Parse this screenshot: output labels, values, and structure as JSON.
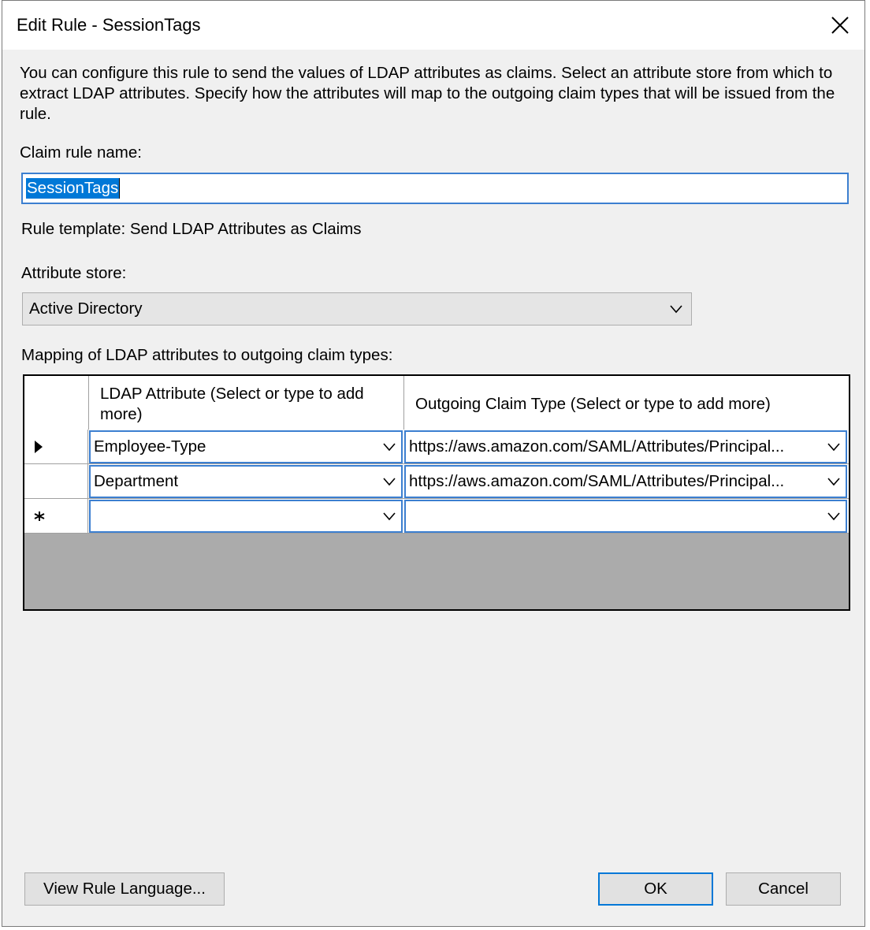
{
  "window": {
    "title": "Edit Rule - SessionTags"
  },
  "dialog": {
    "description": "You can configure this rule to send the values of LDAP attributes as claims. Select an attribute store from which to extract LDAP attributes. Specify how the attributes will map to the outgoing claim types that will be issued from the rule.",
    "claim_rule_name_label": "Claim rule name:",
    "claim_rule_name_value": "SessionTags",
    "rule_template": "Rule template: Send LDAP Attributes as Claims",
    "attribute_store_label": "Attribute store:",
    "attribute_store_value": "Active Directory",
    "mapping_label": "Mapping of LDAP attributes to outgoing claim types:"
  },
  "grid": {
    "columns": [
      "LDAP Attribute (Select or type to add more)",
      "Outgoing Claim Type (Select or type to add more)"
    ],
    "rows": [
      {
        "ldap": "Employee-Type",
        "claim": "https://aws.amazon.com/SAML/Attributes/Principal..."
      },
      {
        "ldap": "Department",
        "claim": "https://aws.amazon.com/SAML/Attributes/Principal..."
      },
      {
        "ldap": "",
        "claim": ""
      }
    ]
  },
  "buttons": {
    "view_rule_language": "View Rule Language...",
    "ok": "OK",
    "cancel": "Cancel"
  },
  "icons": [
    "close-icon",
    "chevron-down-icon",
    "row-selector-icon",
    "new-row-icon"
  ]
}
